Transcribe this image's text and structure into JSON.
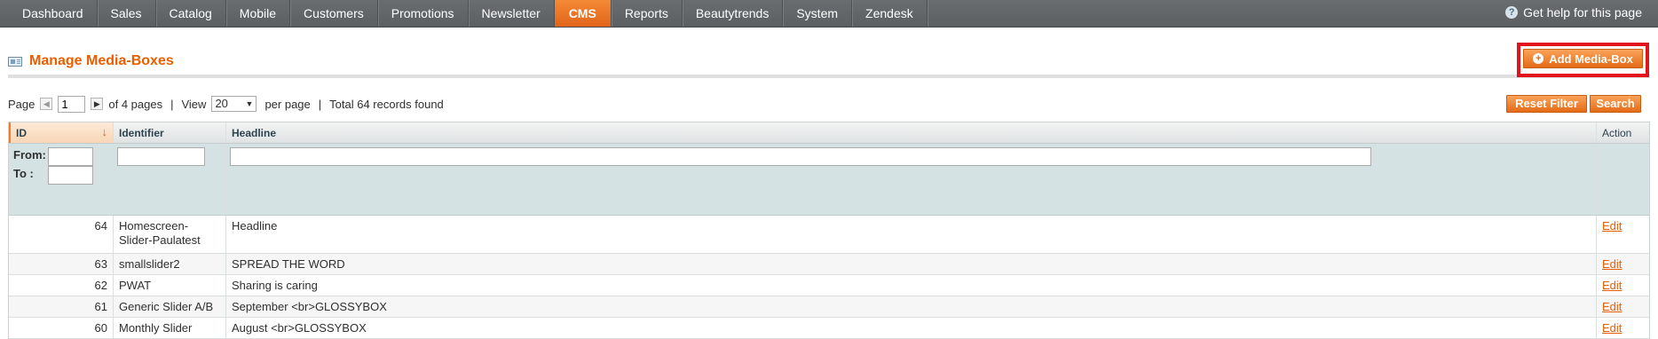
{
  "nav": {
    "items": [
      "Dashboard",
      "Sales",
      "Catalog",
      "Mobile",
      "Customers",
      "Promotions",
      "Newsletter",
      "CMS",
      "Reports",
      "Beautytrends",
      "System",
      "Zendesk"
    ],
    "active": "CMS",
    "help": "Get help for this page"
  },
  "header": {
    "title": "Manage Media-Boxes",
    "add_button": "Add Media-Box"
  },
  "pager": {
    "page_label": "Page",
    "page_value": "1",
    "of_pages": "of 4 pages",
    "view_label": "View",
    "view_value": "20",
    "per_page": "per page",
    "total": "Total 64 records found",
    "sep": "|"
  },
  "actions": {
    "reset": "Reset Filter",
    "search": "Search"
  },
  "grid": {
    "columns": {
      "id": "ID",
      "identifier": "Identifier",
      "headline": "Headline",
      "action": "Action"
    },
    "filters": {
      "from": "From:",
      "to": "To :"
    },
    "rows": [
      {
        "id": "64",
        "identifier": "Homescreen-Slider-Paulatest",
        "headline": "Headline",
        "action": "Edit"
      },
      {
        "id": "63",
        "identifier": "smallslider2",
        "headline": "SPREAD THE WORD",
        "action": "Edit"
      },
      {
        "id": "62",
        "identifier": "PWAT",
        "headline": "Sharing is caring",
        "action": "Edit"
      },
      {
        "id": "61",
        "identifier": "Generic Slider A/B",
        "headline": "September <br>GLOSSYBOX",
        "action": "Edit"
      },
      {
        "id": "60",
        "identifier": "Monthly Slider",
        "headline": "August <br>GLOSSYBOX",
        "action": "Edit"
      }
    ]
  },
  "colors": {
    "accent": "#eb5e00",
    "nav": "#5c5f62",
    "highlight": "#e2131d"
  }
}
